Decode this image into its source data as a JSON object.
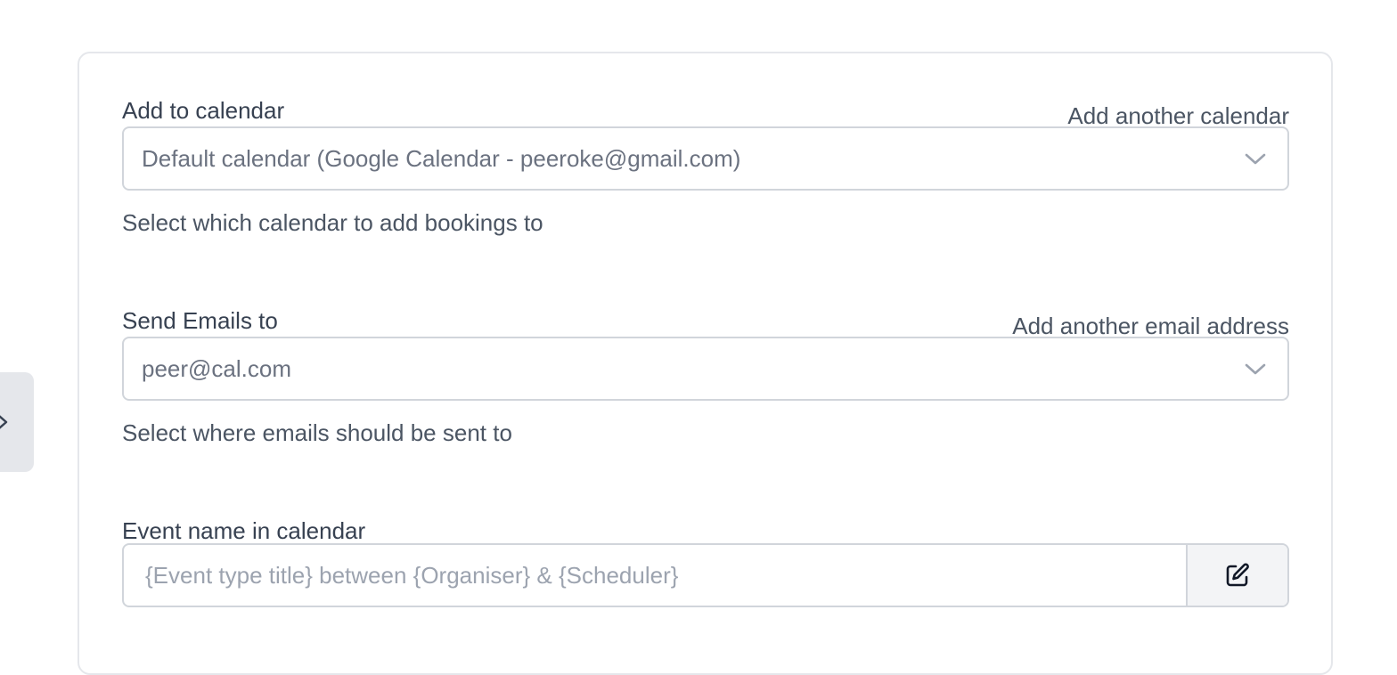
{
  "calendar": {
    "label": "Add to calendar",
    "add_link": "Add another calendar",
    "selected": "Default calendar (Google Calendar - peeroke@gmail.com)",
    "helper": "Select which calendar to add bookings to"
  },
  "emails": {
    "label": "Send Emails to",
    "add_link": "Add another email address",
    "selected": "peer@cal.com",
    "helper": "Select where emails should be sent to"
  },
  "event_name": {
    "label": "Event name in calendar",
    "placeholder": "{Event type title} between {Organiser} & {Scheduler}"
  },
  "icons": {
    "sidebar_toggle": "chevron-right-icon",
    "select_chevron": "chevron-down-icon",
    "edit": "edit-icon"
  }
}
